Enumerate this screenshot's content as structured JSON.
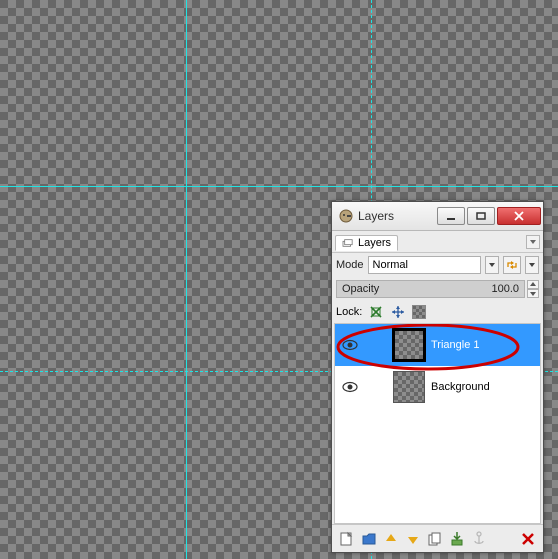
{
  "window": {
    "title": "Layers"
  },
  "tab": {
    "label": "Layers"
  },
  "mode": {
    "label": "Mode",
    "value": "Normal"
  },
  "opacity": {
    "label": "Opacity",
    "value": "100.0"
  },
  "lock": {
    "label": "Lock:"
  },
  "layers": [
    {
      "name": "Triangle 1",
      "visible": true,
      "selected": true
    },
    {
      "name": "Background",
      "visible": true,
      "selected": false
    }
  ],
  "guides": {
    "h1": 186,
    "h2": 371,
    "v1": 186,
    "v2": 371
  },
  "icons": {
    "eye": "eye-icon",
    "new": "new-layer-icon"
  }
}
